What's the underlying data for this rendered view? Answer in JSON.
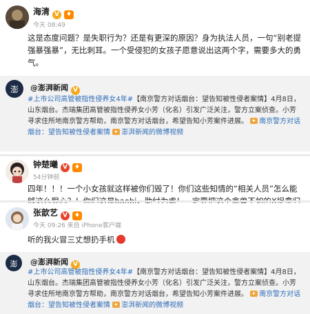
{
  "posts": [
    {
      "username": "海清",
      "time": "今天 08:49",
      "body": "这是态度问题？是失职行为？还是有更深的原因？身为执法人员，一句“别老提强暴强暴”，无比刺耳。一个受侵犯的女孩子愿意说出这两个字，需要多大的勇气。"
    },
    {
      "username": "钟楚曦",
      "time": "54分钟前",
      "body": "四年！！！一个小女孩就这样被你们毁了！你们这些知情的“相关人员”怎么能够这么狠心？！你们这是baobi，助纣为虐！一定要把这个禽兽不如的X捉拿归案以及严惩这些没有良心的“相关人员”！！！"
    },
    {
      "username": "张歆艺",
      "time": "今天 09:26 来自 iPhone客户端",
      "body": "听的我火冒三丈想扔手机"
    }
  ],
  "quote": {
    "source_name": "@澎湃新闻",
    "topic_tag": "#上市公司高管被指性侵养女4年#",
    "text_bracket": "【南京警方对话烟台：望告知被性侵者案情】",
    "text_body": "4月8日，山东烟台。杰瑞集团高管被指性侵养女小芳（化名）引发广泛关注，警方立案侦查。小芳寻求住所地南京警方帮助，南京警方对话烟台，希望告知小芳案件进展。",
    "link_text": "南京警方对话烟台：望告知被性侵者案情",
    "video_label": "澎湃新闻的微博视频"
  },
  "colors": {
    "link": "#2f6db8",
    "quote_bg": "#f2f2f2",
    "meta": "#9a9a9a"
  },
  "icons": [
    "avatar-haiqing",
    "avatar-zhongchuxi",
    "avatar-zhangxinyi",
    "avatar-pengpai",
    "verified-badge",
    "vip-badge",
    "video-icon",
    "angry-emoji"
  ]
}
